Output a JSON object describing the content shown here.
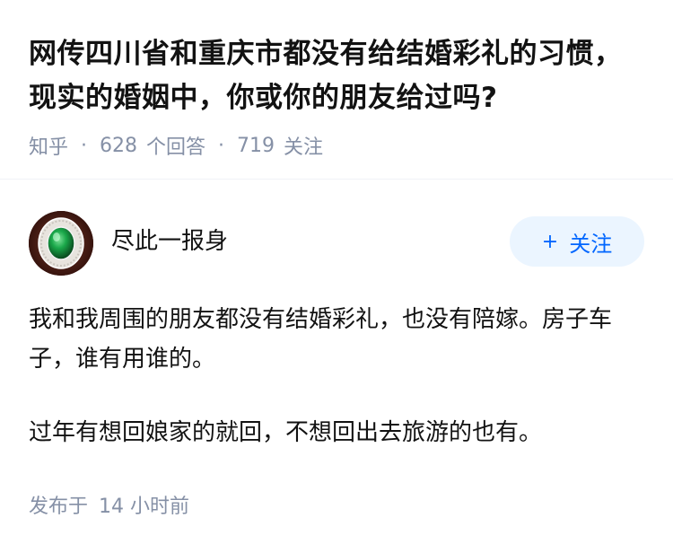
{
  "question": {
    "title": "网传四川省和重庆市都没有给结婚彩礼的习惯，现实的婚姻中，你或你的朋友给过吗?",
    "source": "知乎",
    "separator": "·",
    "answers_count": "628",
    "answers_label": "个回答",
    "followers_count": "719",
    "followers_label": "关注"
  },
  "author": {
    "name": "尽此一报身",
    "avatar_icon": "emerald-ring-avatar",
    "follow_label": "关注",
    "follow_icon": "plus-icon"
  },
  "answer": {
    "paragraphs": [
      "我和我周围的朋友都没有结婚彩礼，也没有陪嫁。房子车子，谁有用谁的。",
      "过年有想回娘家的就回，不想回出去旅游的也有。"
    ],
    "published_label": "发布于",
    "published_time": "14 小时前"
  },
  "colors": {
    "text": "#121212",
    "meta": "#8590a6",
    "accent": "#0066ff",
    "follow_bg": "#ebf5ff"
  }
}
